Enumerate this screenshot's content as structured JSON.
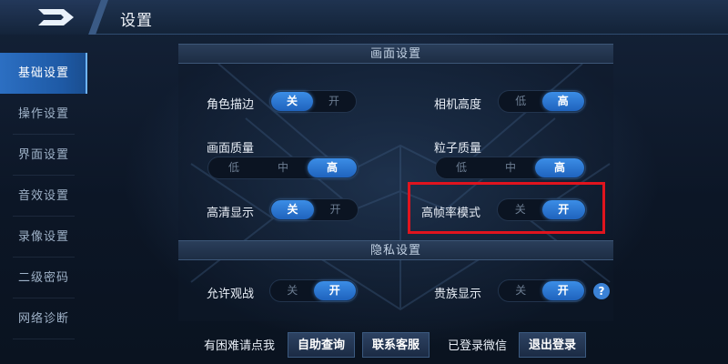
{
  "header": {
    "title": "设置",
    "back_icon": "back-arrow-icon"
  },
  "sidebar": {
    "items": [
      {
        "label": "基础设置",
        "active": true
      },
      {
        "label": "操作设置",
        "active": false
      },
      {
        "label": "界面设置",
        "active": false
      },
      {
        "label": "音效设置",
        "active": false
      },
      {
        "label": "录像设置",
        "active": false
      },
      {
        "label": "二级密码",
        "active": false
      },
      {
        "label": "网络诊断",
        "active": false
      }
    ]
  },
  "sections": {
    "display": {
      "title": "画面设置"
    },
    "privacy": {
      "title": "隐私设置"
    }
  },
  "settings": {
    "outline": {
      "label": "角色描边",
      "options": [
        "关",
        "开"
      ],
      "selected": "关"
    },
    "camera_height": {
      "label": "相机高度",
      "options": [
        "低",
        "高"
      ],
      "selected": "高"
    },
    "quality": {
      "label": "画面质量",
      "options": [
        "低",
        "中",
        "高"
      ],
      "selected": "高"
    },
    "particles": {
      "label": "粒子质量",
      "options": [
        "低",
        "中",
        "高"
      ],
      "selected": "高"
    },
    "hd_display": {
      "label": "高清显示",
      "options": [
        "关",
        "开"
      ],
      "selected": "关"
    },
    "high_fps": {
      "label": "高帧率模式",
      "options": [
        "关",
        "开"
      ],
      "selected": "开"
    },
    "allow_watch": {
      "label": "允许观战",
      "options": [
        "关",
        "开"
      ],
      "selected": "开"
    },
    "noble_display": {
      "label": "贵族显示",
      "options": [
        "关",
        "开"
      ],
      "selected": "开"
    }
  },
  "help": {
    "glyph": "?"
  },
  "footer": {
    "help_text": "有困难请点我",
    "self_help_button": "自助查询",
    "contact_button": "联系客服",
    "wechat_text": "已登录微信",
    "logout_button": "退出登录"
  },
  "colors": {
    "accent": "#2f7ad6",
    "highlight": "#e0141e"
  }
}
